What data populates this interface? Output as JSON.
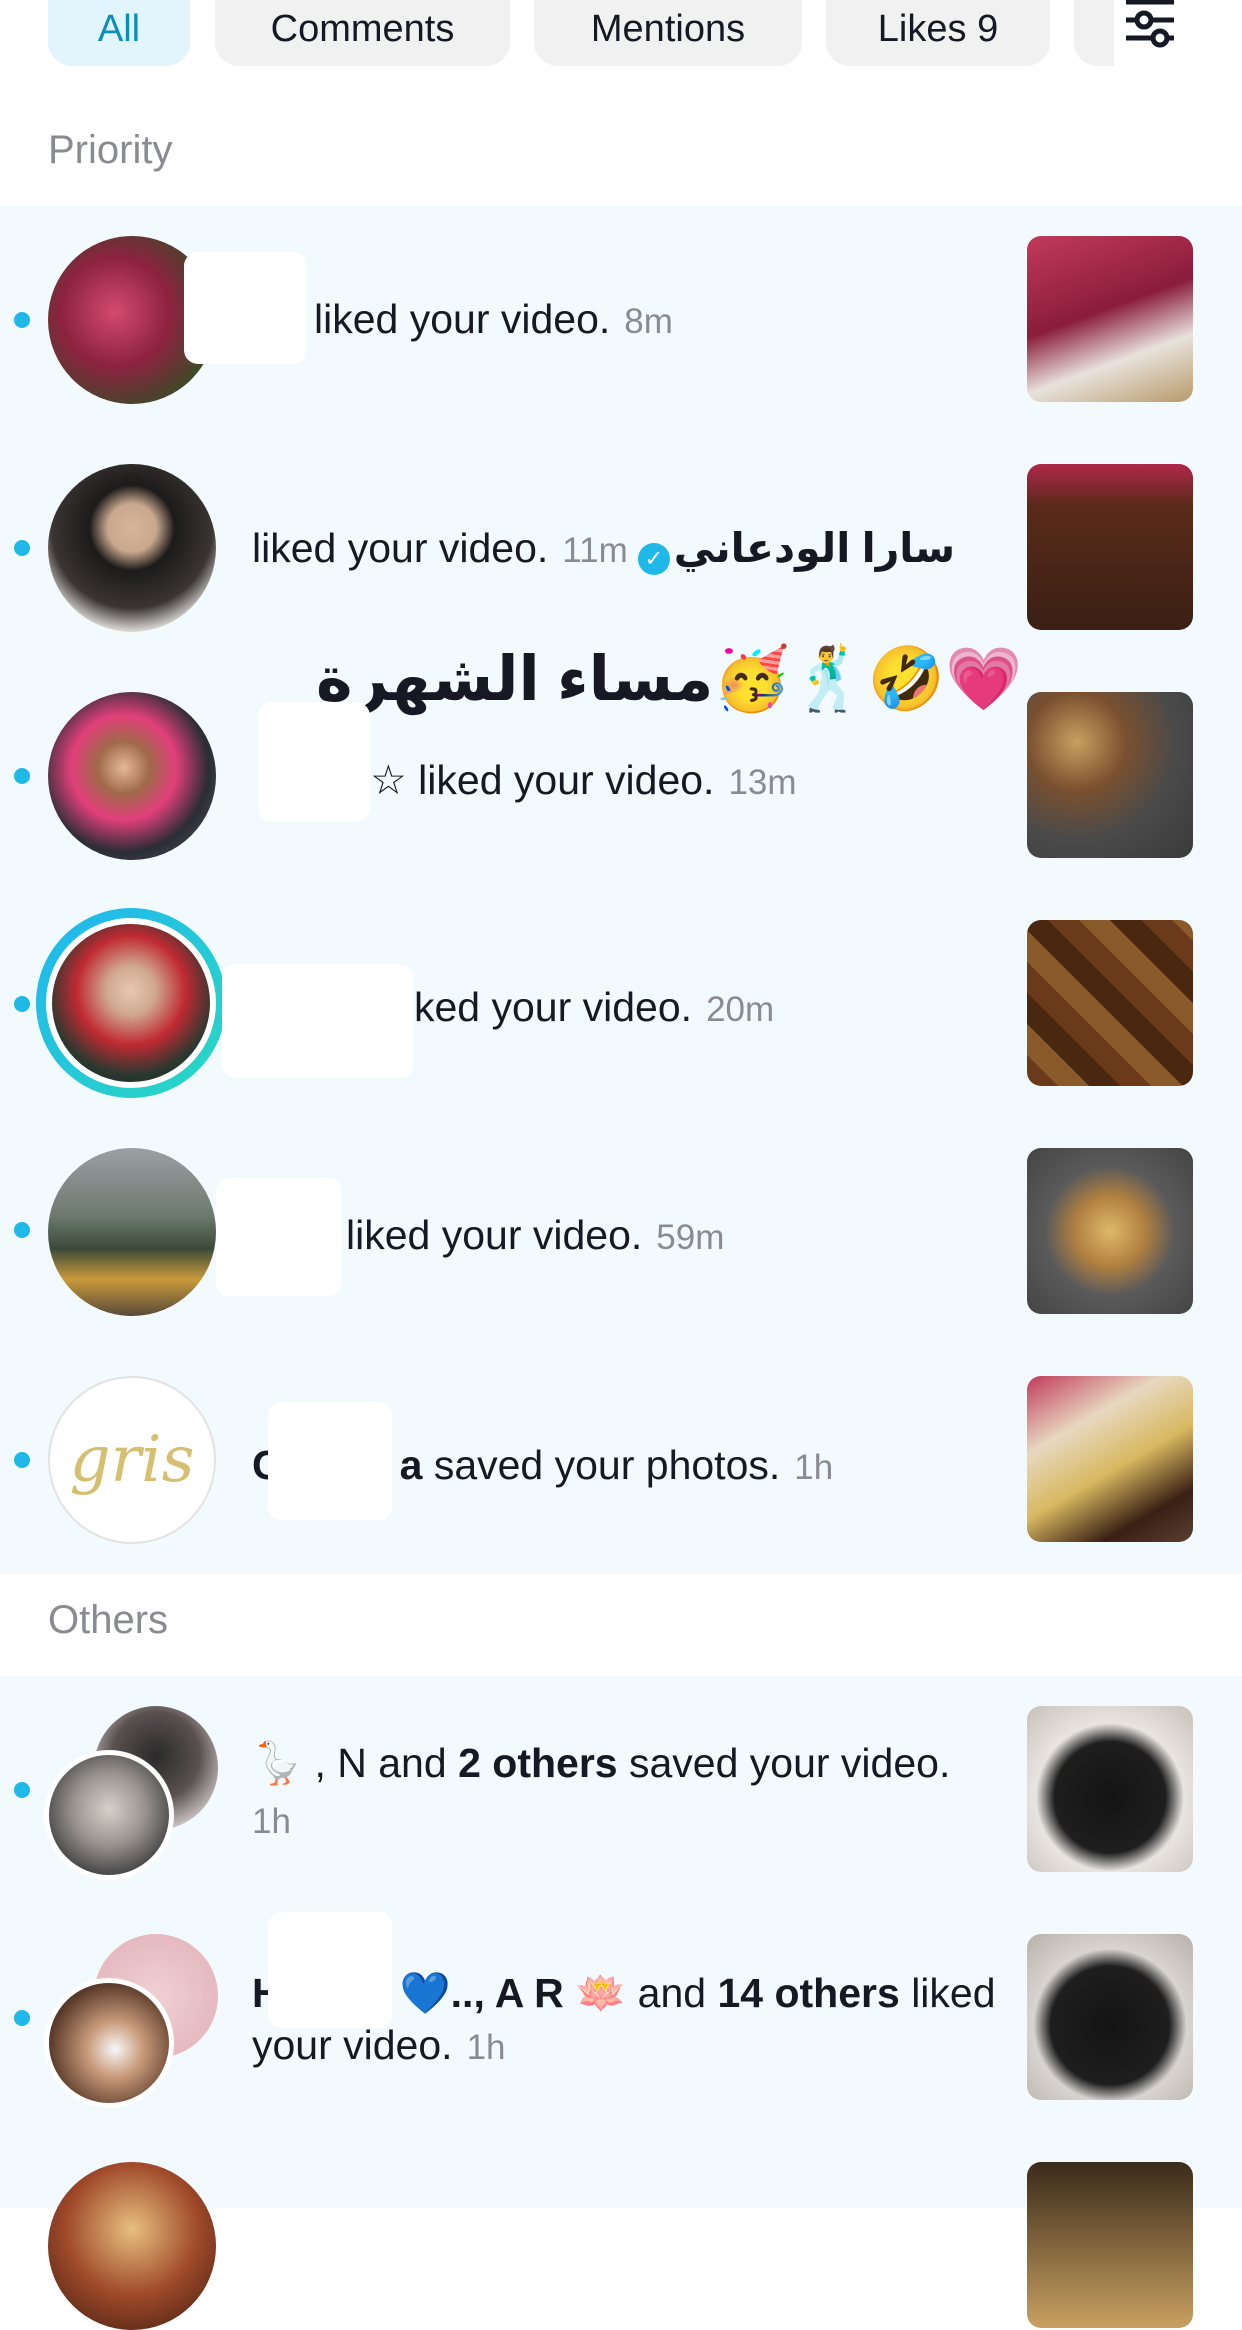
{
  "tabs": {
    "all": "All",
    "comments": "Comments",
    "mentions": "Mentions",
    "likes": "Likes 9"
  },
  "sections": {
    "priority": "Priority",
    "others": "Others"
  },
  "notifications": [
    {
      "text": "liked your video.",
      "time": "8m"
    },
    {
      "text": "liked your video.",
      "time": "11m",
      "name": "سارا الودعاني",
      "caption": "مساء الشهرة🥳🕺🤣💗"
    },
    {
      "prefix": "☆",
      "text": "liked your video.",
      "time": "13m"
    },
    {
      "text": "ked your video.",
      "time": "20m"
    },
    {
      "text": "liked your video.",
      "time": "59m"
    },
    {
      "name_start": "C",
      "name_end": "a",
      "text": "saved your photos.",
      "time": "1h"
    }
  ],
  "others": [
    {
      "names": "🪿 , N",
      "and": "and",
      "count": "2 others",
      "text": "saved your video.",
      "time": "1h"
    },
    {
      "names_start": "H",
      "names_end": "💙.., A R 🪷",
      "and": "and",
      "count": "14 others",
      "text1": "liked",
      "text2": "your video.",
      "time": "1h"
    }
  ],
  "colors": {
    "accent": "#20b8e8",
    "row_bg": "#f2fafd",
    "tab_active_bg": "#e3f5fc",
    "tab_active_text": "#0b8fb8"
  }
}
